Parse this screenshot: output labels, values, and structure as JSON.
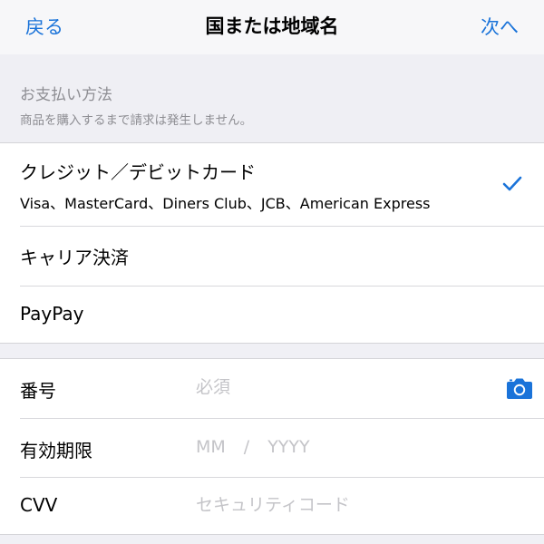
{
  "nav": {
    "back_label": "戻る",
    "title": "国または地域名",
    "next_label": "次へ"
  },
  "payment_section": {
    "title": "お支払い方法",
    "subtitle": "商品を購入するまで請求は発生しません。"
  },
  "payment_methods": [
    {
      "label": "クレジット／デビットカード",
      "sublabel": "Visa、MasterCard、Diners Club、JCB、American Express",
      "selected": true
    },
    {
      "label": "キャリア決済",
      "selected": false
    },
    {
      "label": "PayPay",
      "selected": false
    }
  ],
  "card_fields": {
    "number": {
      "label": "番号",
      "placeholder": "必須"
    },
    "expiry": {
      "label": "有効期限",
      "month_placeholder": "MM",
      "separator": "/",
      "year_placeholder": "YYYY"
    },
    "cvv": {
      "label": "CVV",
      "placeholder": "セキュリティコード"
    }
  },
  "colors": {
    "accent": "#1a73d9",
    "placeholder": "#c4c4c8",
    "section_text": "#8e8e93",
    "background": "#efeff4"
  },
  "icons": {
    "selected_indicator": "checkmark-icon",
    "scan_card": "camera-icon"
  }
}
